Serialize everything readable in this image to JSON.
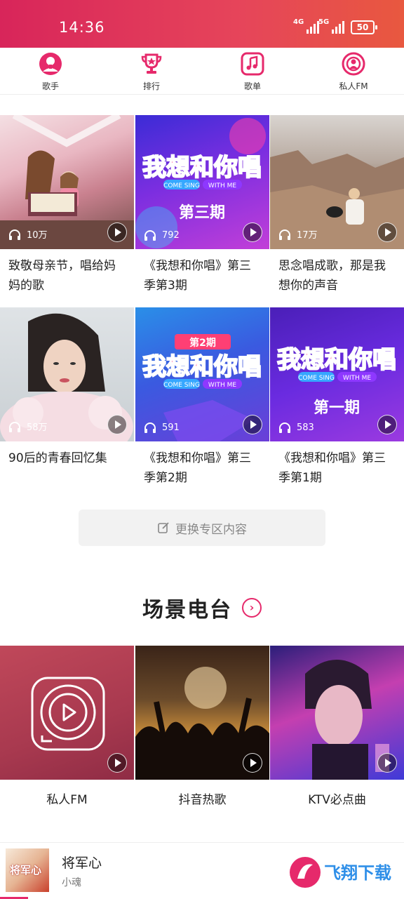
{
  "status_bar": {
    "time": "14:36",
    "net1": "4G",
    "net2": "5G",
    "battery": "50"
  },
  "top_nav": [
    {
      "label": "歌手",
      "icon": "singer-icon"
    },
    {
      "label": "排行",
      "icon": "trophy-icon"
    },
    {
      "label": "歌单",
      "icon": "music-note-icon"
    },
    {
      "label": "私人FM",
      "icon": "radio-icon"
    }
  ],
  "playlists": [
    {
      "title": "致敬母亲节，唱给妈妈的歌",
      "plays": "10万"
    },
    {
      "title": "《我想和你唱》第三季第3期",
      "plays": "792",
      "cover_text": "第三期"
    },
    {
      "title": "思念唱成歌，那是我想你的声音",
      "plays": "17万"
    },
    {
      "title": "90后的青春回忆集",
      "plays": "58万"
    },
    {
      "title": "《我想和你唱》第三季第2期",
      "plays": "591",
      "cover_text": "第2期"
    },
    {
      "title": "《我想和你唱》第三季第1期",
      "plays": "583",
      "cover_text": "第一期"
    }
  ],
  "show_logo": {
    "main": "我想和你唱",
    "sub1": "COME SING",
    "sub2": "WITH ME"
  },
  "refresh_label": "更换专区内容",
  "scene_section": {
    "title": "场景电台",
    "arrow": "›"
  },
  "scenes": [
    {
      "label": "私人FM"
    },
    {
      "label": "抖音热歌"
    },
    {
      "label": "KTV必点曲"
    }
  ],
  "player": {
    "song": "将军心",
    "artist": "小魂",
    "cover_text": "将军心"
  },
  "watermark": "飞翔下载",
  "colors": {
    "accent": "#e6296b",
    "statusbar": "#d8255a"
  }
}
